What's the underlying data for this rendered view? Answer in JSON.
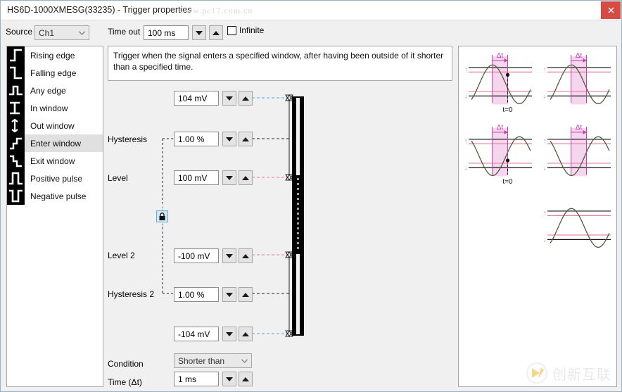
{
  "window": {
    "title": "HS6D-1000XMESG(33235) - Trigger properties",
    "watermark_top": "www.pc17.com.cn",
    "close_label": "✕"
  },
  "toolbar": {
    "source_label": "Source",
    "source_value": "Ch1",
    "timeout_label": "Time out",
    "timeout_value": "100 ms",
    "infinite_label": "Infinite"
  },
  "trigger_types": [
    {
      "label": "Rising edge",
      "icon": "rising-edge-icon",
      "selected": false
    },
    {
      "label": "Falling edge",
      "icon": "falling-edge-icon",
      "selected": false
    },
    {
      "label": "Any edge",
      "icon": "any-edge-icon",
      "selected": false
    },
    {
      "label": "In window",
      "icon": "in-window-icon",
      "selected": false
    },
    {
      "label": "Out window",
      "icon": "out-window-icon",
      "selected": false
    },
    {
      "label": "Enter window",
      "icon": "enter-window-icon",
      "selected": true
    },
    {
      "label": "Exit window",
      "icon": "exit-window-icon",
      "selected": false
    },
    {
      "label": "Positive pulse",
      "icon": "positive-pulse-icon",
      "selected": false
    },
    {
      "label": "Negative pulse",
      "icon": "negative-pulse-icon",
      "selected": false
    }
  ],
  "description": "Trigger when the signal enters a specified window, after having been outside of it shorter than a specified time.",
  "params": {
    "upper_bound_value": "104 mV",
    "hysteresis_label": "Hysteresis",
    "hysteresis_value": "1.00 %",
    "level_label": "Level",
    "level_value": "100 mV",
    "level2_label": "Level 2",
    "level2_value": "-100 mV",
    "hysteresis2_label": "Hysteresis 2",
    "hysteresis2_value": "1.00 %",
    "lower_bound_value": "-104 mV",
    "condition_label": "Condition",
    "condition_value": "Shorter than",
    "time_label": "Time (Δt)",
    "time_value": "1 ms"
  },
  "preview": {
    "delta_t_label": "Δt",
    "t_zero_label": "t=0",
    "level_marker_upper": "↑",
    "level_marker_lower": "↓",
    "cells": [
      {
        "name": "preview-top-left",
        "delta": true,
        "tzero": true,
        "phase": "up"
      },
      {
        "name": "preview-top-right",
        "delta": true,
        "tzero": false,
        "phase": "up"
      },
      {
        "name": "preview-mid-left",
        "delta": true,
        "tzero": true,
        "phase": "down"
      },
      {
        "name": "preview-mid-right",
        "delta": true,
        "tzero": false,
        "phase": "down"
      },
      {
        "name": "preview-bottom-right",
        "delta": false,
        "tzero": false,
        "phase": "up"
      }
    ]
  },
  "watermark_bottom": {
    "text": "创新互联"
  },
  "colors": {
    "accent_blue": "#6aa8cc",
    "level_red": "#e77d9a",
    "bound_blue": "#5aa0d8",
    "delta_pink": "#f6d5ef",
    "delta_stroke": "#c040a8",
    "wave_green": "#4d5e3c",
    "close_red": "#d64b42",
    "selected_row": "#e0e0e0"
  }
}
